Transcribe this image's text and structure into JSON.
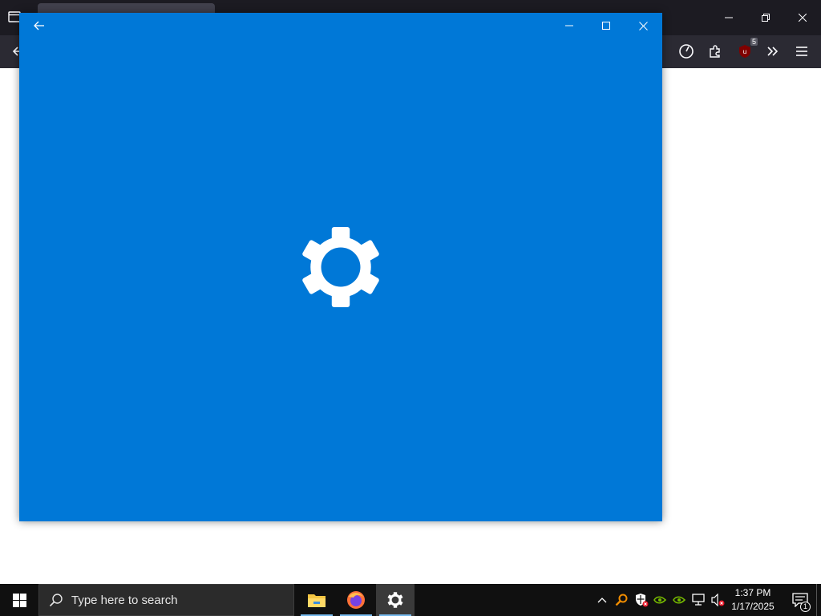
{
  "browser": {
    "toolbar": {
      "ublock_badge": "5"
    },
    "icons": [
      "tab-list-icon",
      "minimize-icon",
      "restore-icon",
      "close-icon",
      "back-arrow-icon",
      "performance-gauge-icon",
      "extensions-puzzle-icon",
      "ublock-icon",
      "overflow-chevrons-icon",
      "hamburger-menu-icon"
    ]
  },
  "settings_window": {
    "background_color": "#0078d7",
    "state": "loading splash",
    "icons": [
      "back-arrow-icon",
      "minimize-icon",
      "maximize-icon",
      "close-icon",
      "settings-gear-icon"
    ]
  },
  "taskbar": {
    "search_placeholder": "Type here to search",
    "pinned_apps": [
      {
        "name": "File Explorer",
        "icon": "file-explorer-icon"
      },
      {
        "name": "Firefox",
        "icon": "firefox-icon"
      },
      {
        "name": "Settings",
        "icon": "settings-gear-icon",
        "active": true
      }
    ],
    "tray_icons": [
      "show-hidden-icons-chevron",
      "search-magnifier-icon",
      "security-shield-icon",
      "nvidia-icon",
      "nvidia-icon",
      "network-icon",
      "volume-muted-icon"
    ],
    "clock": {
      "time": "1:37 PM",
      "date": "1/17/2025"
    },
    "notification_count": "1"
  }
}
